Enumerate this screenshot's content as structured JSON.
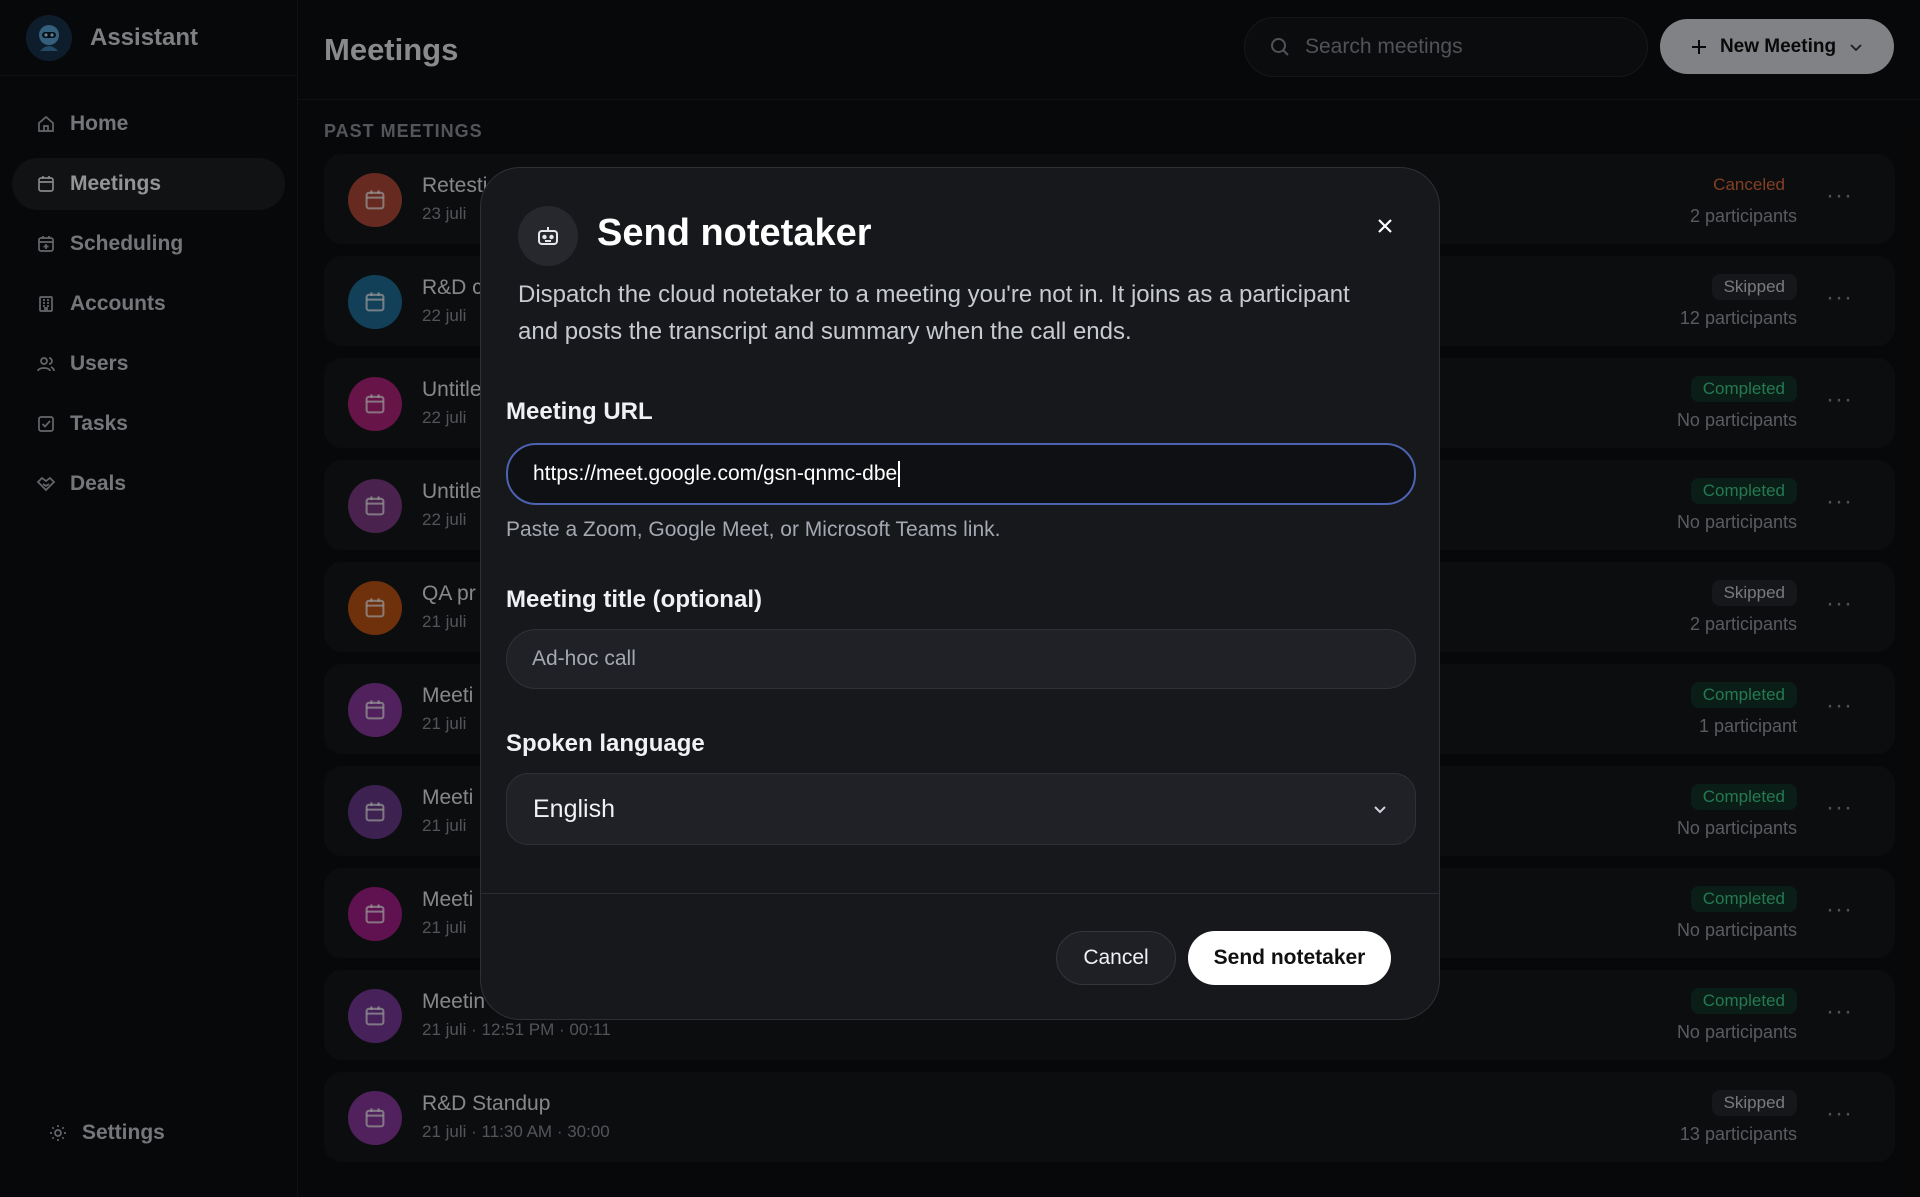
{
  "sidebar": {
    "app_name": "Assistant",
    "items": [
      {
        "label": "Home",
        "icon": "home-icon"
      },
      {
        "label": "Meetings",
        "icon": "calendar-icon",
        "active": true
      },
      {
        "label": "Scheduling",
        "icon": "calendar-plus-icon"
      },
      {
        "label": "Accounts",
        "icon": "building-icon"
      },
      {
        "label": "Users",
        "icon": "users-icon"
      },
      {
        "label": "Tasks",
        "icon": "checkbox-icon"
      },
      {
        "label": "Deals",
        "icon": "handshake-icon"
      }
    ],
    "settings_label": "Settings"
  },
  "header": {
    "title": "Meetings",
    "search_placeholder": "Search meetings",
    "new_meeting_label": "New Meeting"
  },
  "list": {
    "section_label": "PAST MEETINGS",
    "rows": [
      {
        "title": "Retesti",
        "sub": "23 juli",
        "status": "Canceled",
        "status_kind": "canceled",
        "participants": "2 participants",
        "color": "#b0493a"
      },
      {
        "title": "R&D c",
        "sub": "22 juli",
        "status": "Skipped",
        "status_kind": "skipped",
        "participants": "12 participants",
        "color": "#1f6f9a"
      },
      {
        "title": "Untitle",
        "sub": "22 juli",
        "status": "Completed",
        "status_kind": "completed",
        "participants": "No participants",
        "color": "#b2237e"
      },
      {
        "title": "Untitle",
        "sub": "22 juli",
        "status": "Completed",
        "status_kind": "completed",
        "participants": "No participants",
        "color": "#7e3b86"
      },
      {
        "title": "QA pr",
        "sub": "21 juli",
        "status": "Skipped",
        "status_kind": "skipped",
        "participants": "2 participants",
        "color": "#c05316"
      },
      {
        "title": "Meeti",
        "sub": "21 juli",
        "status": "Completed",
        "status_kind": "completed",
        "participants": "1 participant",
        "color": "#8a3aa0"
      },
      {
        "title": "Meeti",
        "sub": "21 juli",
        "status": "Completed",
        "status_kind": "completed",
        "participants": "No participants",
        "color": "#6a3b8c"
      },
      {
        "title": "Meeti",
        "sub": "21 juli",
        "status": "Completed",
        "status_kind": "completed",
        "participants": "No participants",
        "color": "#a61f8a"
      },
      {
        "title": "Meetin",
        "sub": "21 juli · 12:51 PM · 00:11",
        "status": "Completed",
        "status_kind": "completed",
        "participants": "No participants",
        "color": "#7a3a9a"
      },
      {
        "title": "R&D Standup",
        "sub": "21 juli · 11:30 AM · 30:00",
        "status": "Skipped",
        "status_kind": "skipped",
        "participants": "13 participants",
        "color": "#8a3aa0"
      }
    ]
  },
  "modal": {
    "title": "Send notetaker",
    "description": "Dispatch the cloud notetaker to a meeting you're not in. It joins as a participant and posts the transcript and summary when the call ends.",
    "url_label": "Meeting URL",
    "url_value": "https://meet.google.com/gsn-qnmc-dbe",
    "url_hint": "Paste a Zoom, Google Meet, or Microsoft Teams link.",
    "title_label": "Meeting title (optional)",
    "title_placeholder": "Ad-hoc call",
    "language_label": "Spoken language",
    "language_value": "English",
    "cancel_label": "Cancel",
    "send_label": "Send notetaker"
  }
}
